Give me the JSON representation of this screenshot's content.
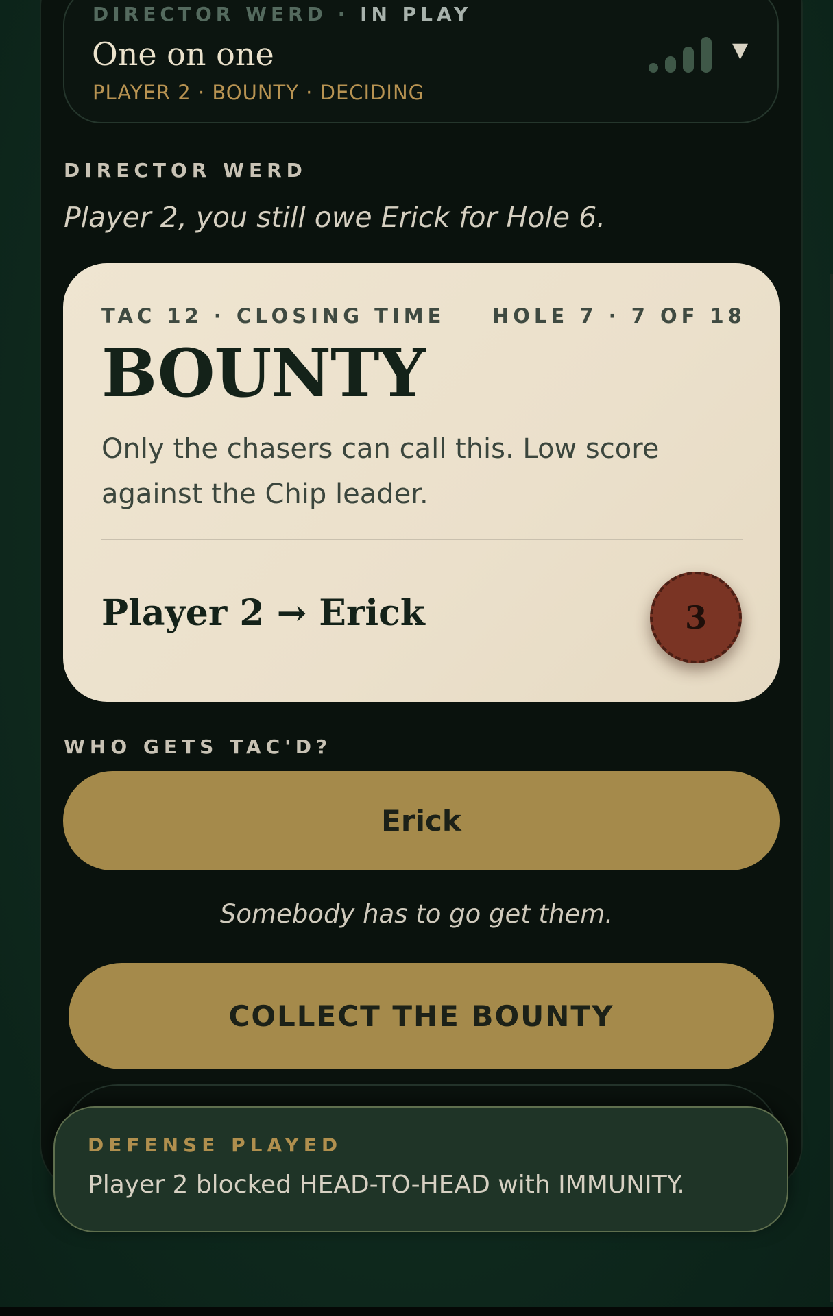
{
  "header": {
    "director": "DIRECTOR WERD",
    "separator": "·",
    "status": "IN PLAY",
    "title": "One on one",
    "subtitle": "PLAYER 2 · BOUNTY · DECIDING",
    "signal_icon": "signal-bars-icon",
    "menu_icon": "chevron-down-icon",
    "menu_glyph": "▼"
  },
  "director_section": {
    "label": "DIRECTOR WERD",
    "message": "Player 2, you still owe Erick for Hole 6."
  },
  "card": {
    "meta_left": "TAC 12 · CLOSING TIME",
    "meta_right": "HOLE 7 · 7 OF 18",
    "title": "BOUNTY",
    "description": "Only the chasers can call this. Low score against the Chip leader.",
    "matchup": "Player 2 → Erick",
    "chip_value": "3",
    "chip_color": "#7a3424"
  },
  "target_section": {
    "label": "WHO GETS TAC'D?",
    "option": "Erick",
    "hint": "Somebody has to go get them."
  },
  "cta": {
    "label": "COLLECT THE BOUNTY"
  },
  "toast": {
    "title": "DEFENSE PLAYED",
    "body": "Player 2 blocked HEAD-TO-HEAD with IMMUNITY."
  },
  "colors": {
    "background": "#0f2a1e",
    "panel": "#0a120d",
    "card": "#ebe0cb",
    "accent_gold": "#a58a4b",
    "toast_bg": "#1f3427"
  }
}
